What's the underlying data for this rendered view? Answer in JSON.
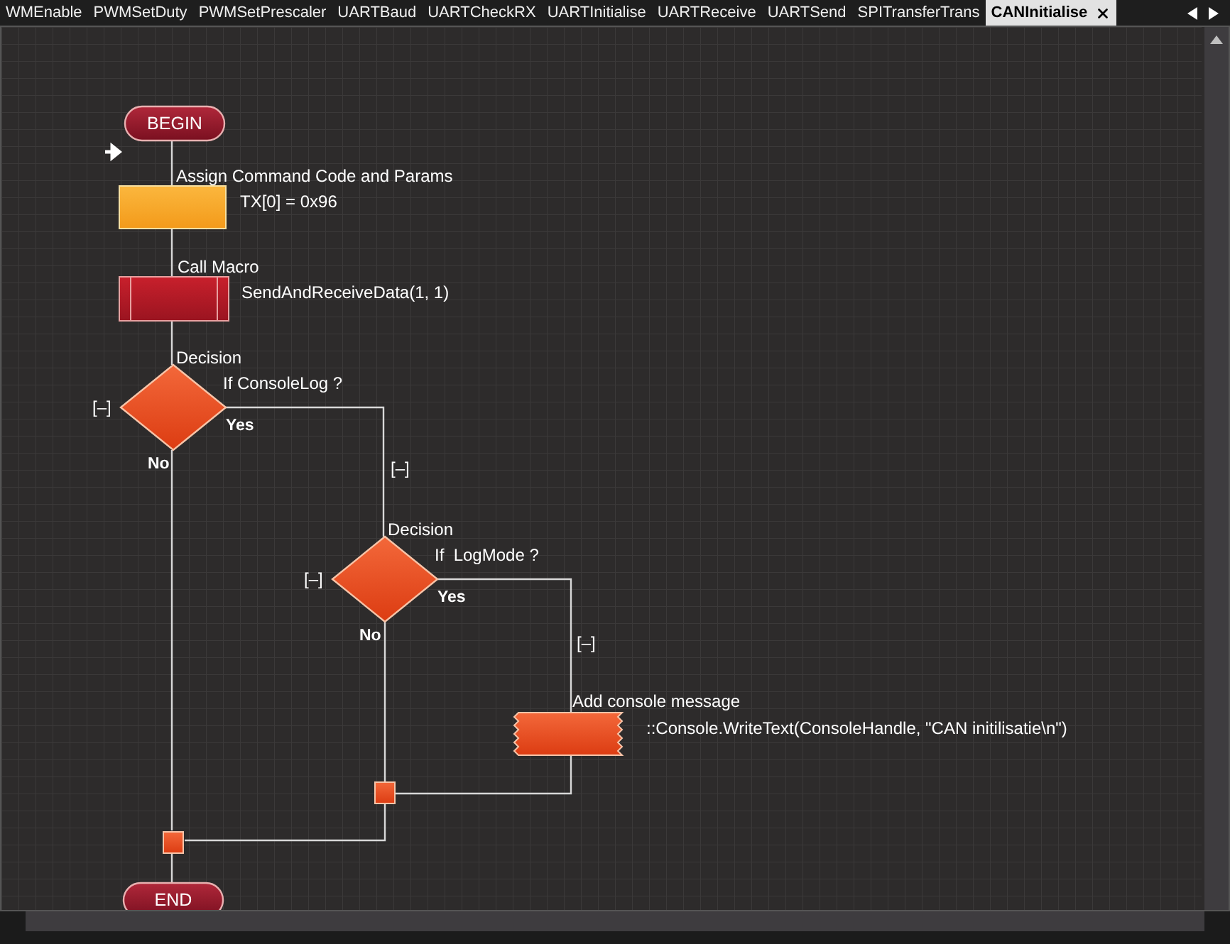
{
  "tabs": [
    {
      "label": "WMEnable",
      "selected": false
    },
    {
      "label": "PWMSetDuty",
      "selected": false
    },
    {
      "label": "PWMSetPrescaler",
      "selected": false
    },
    {
      "label": "UARTBaud",
      "selected": false
    },
    {
      "label": "UARTCheckRX",
      "selected": false
    },
    {
      "label": "UARTInitialise",
      "selected": false
    },
    {
      "label": "UARTReceive",
      "selected": false
    },
    {
      "label": "UARTSend",
      "selected": false
    },
    {
      "label": "SPITransferTrans",
      "selected": false
    },
    {
      "label": "CANInitialise",
      "selected": true
    }
  ],
  "flowchart": {
    "nodes": [
      {
        "kind": "terminal",
        "label": "BEGIN"
      },
      {
        "kind": "calculation",
        "title": "Assign Command Code and Params",
        "detail": "TX[0] = 0x96"
      },
      {
        "kind": "macro",
        "title": "Call Macro",
        "detail": "SendAndReceiveData(1, 1)"
      },
      {
        "kind": "decision",
        "title": "Decision",
        "detail": "If ConsoleLog ?",
        "yes": "Yes",
        "no": "No",
        "toggle": "[–]",
        "branch_toggle": "[–]"
      },
      {
        "kind": "decision",
        "title": "Decision",
        "detail": "If  LogMode ?",
        "yes": "Yes",
        "no": "No",
        "toggle": "[–]",
        "branch_toggle": "[–]"
      },
      {
        "kind": "output",
        "title": "Add console message",
        "detail": "::Console.WriteText(ConsoleHandle, \"CAN initilisatie\\n\")"
      },
      {
        "kind": "junction"
      },
      {
        "kind": "junction"
      },
      {
        "kind": "terminal",
        "label": "END"
      }
    ]
  }
}
